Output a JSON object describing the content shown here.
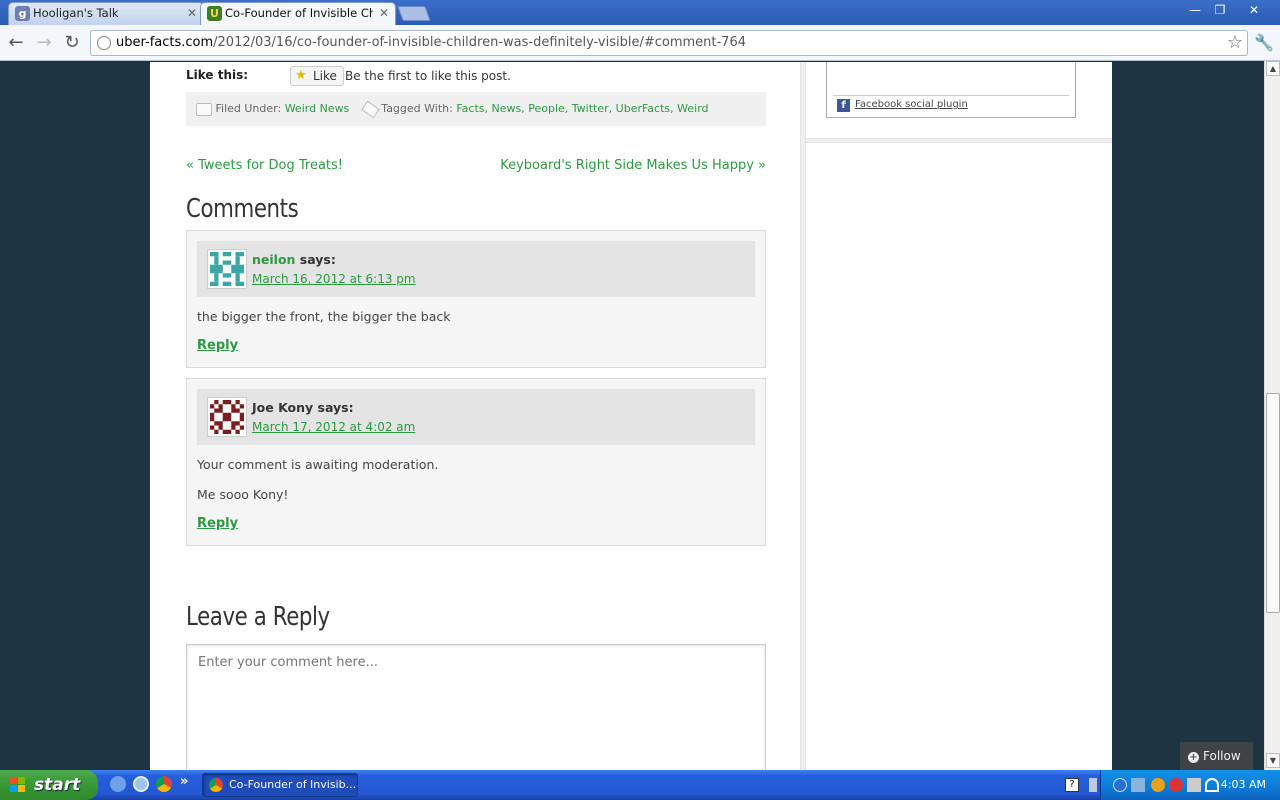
{
  "browser": {
    "tabs": [
      {
        "title": "Hooligan's Talk",
        "favicon": "g-favicon",
        "active": false
      },
      {
        "title": "Co-Founder of Invisible Childre",
        "favicon": "uberfacts-favicon",
        "active": true
      }
    ],
    "url_domain": "uber-facts.com",
    "url_path": "/2012/03/16/co-founder-of-invisible-children-was-definitely-visible/#comment-764",
    "icons": [
      "back-icon",
      "forward-icon",
      "reload-icon",
      "page-icon",
      "star-icon",
      "wrench-icon"
    ]
  },
  "post": {
    "like_title": "Like this:",
    "like_button": "Like",
    "like_text": "Be the first to like this post.",
    "filed_under_label": "Filed Under:",
    "filed_under": "Weird News",
    "tagged_label": "Tagged With:",
    "tags": [
      "Facts",
      "News",
      "People",
      "Twitter",
      "UberFacts",
      "Weird"
    ],
    "prev_link": "« Tweets for Dog Treats!",
    "next_link": "Keyboard's Right Side Makes Us Happy »"
  },
  "comments_title": "Comments",
  "comments": [
    {
      "author": "neilon",
      "says": "says:",
      "date": "March 16, 2012 at 6:13 pm",
      "body": [
        "the bigger the front, the bigger the back"
      ],
      "reply": "Reply"
    },
    {
      "author": "Joe Kony",
      "says": "says:",
      "date": "March 17, 2012 at 4:02 am",
      "body": [
        "Your comment is awaiting moderation.",
        "Me sooo Kony!"
      ],
      "reply": "Reply"
    }
  ],
  "leave_reply": {
    "title": "Leave a Reply",
    "placeholder": "Enter your comment here..."
  },
  "sidebar": {
    "fb_plugin_text": "Facebook social plugin"
  },
  "follow_button": "Follow",
  "taskbar": {
    "start_label": "start",
    "task_item": "Co-Founder of Invisib...",
    "clock": "4:03 AM"
  },
  "colors": {
    "accent_green": "#2b9a3f",
    "page_background": "#1f3442",
    "xp_taskbar": "#245edb",
    "xp_start": "#3c9a3a"
  }
}
